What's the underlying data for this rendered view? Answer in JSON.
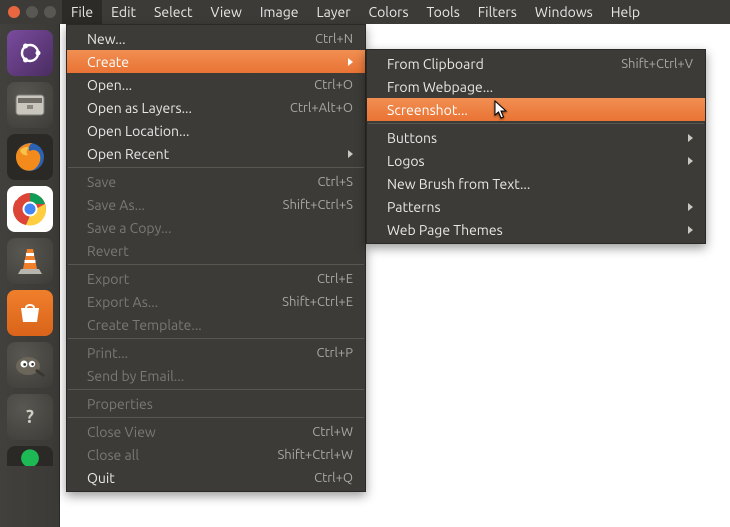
{
  "menubar": {
    "items": [
      "File",
      "Edit",
      "Select",
      "View",
      "Image",
      "Layer",
      "Colors",
      "Tools",
      "Filters",
      "Windows",
      "Help"
    ],
    "open_index": 0
  },
  "file_menu": {
    "groups": [
      [
        {
          "label": "New...",
          "shortcut": "Ctrl+N",
          "sub": false,
          "disabled": false
        },
        {
          "label": "Create",
          "shortcut": "",
          "sub": true,
          "disabled": false,
          "hl": true
        },
        {
          "label": "Open...",
          "shortcut": "Ctrl+O",
          "sub": false,
          "disabled": false
        },
        {
          "label": "Open as Layers...",
          "shortcut": "Ctrl+Alt+O",
          "sub": false,
          "disabled": false
        },
        {
          "label": "Open Location...",
          "shortcut": "",
          "sub": false,
          "disabled": false
        },
        {
          "label": "Open Recent",
          "shortcut": "",
          "sub": true,
          "disabled": false
        }
      ],
      [
        {
          "label": "Save",
          "shortcut": "Ctrl+S",
          "sub": false,
          "disabled": true
        },
        {
          "label": "Save As...",
          "shortcut": "Shift+Ctrl+S",
          "sub": false,
          "disabled": true
        },
        {
          "label": "Save a Copy...",
          "shortcut": "",
          "sub": false,
          "disabled": true
        },
        {
          "label": "Revert",
          "shortcut": "",
          "sub": false,
          "disabled": true
        }
      ],
      [
        {
          "label": "Export",
          "shortcut": "Ctrl+E",
          "sub": false,
          "disabled": true
        },
        {
          "label": "Export As...",
          "shortcut": "Shift+Ctrl+E",
          "sub": false,
          "disabled": true
        },
        {
          "label": "Create Template...",
          "shortcut": "",
          "sub": false,
          "disabled": true
        }
      ],
      [
        {
          "label": "Print...",
          "shortcut": "Ctrl+P",
          "sub": false,
          "disabled": true
        },
        {
          "label": "Send by Email...",
          "shortcut": "",
          "sub": false,
          "disabled": true
        }
      ],
      [
        {
          "label": "Properties",
          "shortcut": "",
          "sub": false,
          "disabled": true
        }
      ],
      [
        {
          "label": "Close View",
          "shortcut": "Ctrl+W",
          "sub": false,
          "disabled": true
        },
        {
          "label": "Close all",
          "shortcut": "Shift+Ctrl+W",
          "sub": false,
          "disabled": true
        },
        {
          "label": "Quit",
          "shortcut": "Ctrl+Q",
          "sub": false,
          "disabled": false
        }
      ]
    ]
  },
  "create_menu": {
    "groups": [
      [
        {
          "label": "From Clipboard",
          "shortcut": "Shift+Ctrl+V",
          "sub": false,
          "disabled": false
        },
        {
          "label": "From Webpage...",
          "shortcut": "",
          "sub": false,
          "disabled": false
        },
        {
          "label": "Screenshot...",
          "shortcut": "",
          "sub": false,
          "disabled": false,
          "hl": true
        }
      ],
      [
        {
          "label": "Buttons",
          "shortcut": "",
          "sub": true,
          "disabled": false
        },
        {
          "label": "Logos",
          "shortcut": "",
          "sub": true,
          "disabled": false
        },
        {
          "label": "New Brush from Text...",
          "shortcut": "",
          "sub": false,
          "disabled": false
        },
        {
          "label": "Patterns",
          "shortcut": "",
          "sub": true,
          "disabled": false
        },
        {
          "label": "Web Page Themes",
          "shortcut": "",
          "sub": true,
          "disabled": false
        }
      ]
    ]
  },
  "launcher": {
    "icons": [
      "ubuntu-dash",
      "files",
      "firefox",
      "chrome",
      "vlc",
      "software-center",
      "gimp",
      "help",
      "spotify"
    ]
  }
}
